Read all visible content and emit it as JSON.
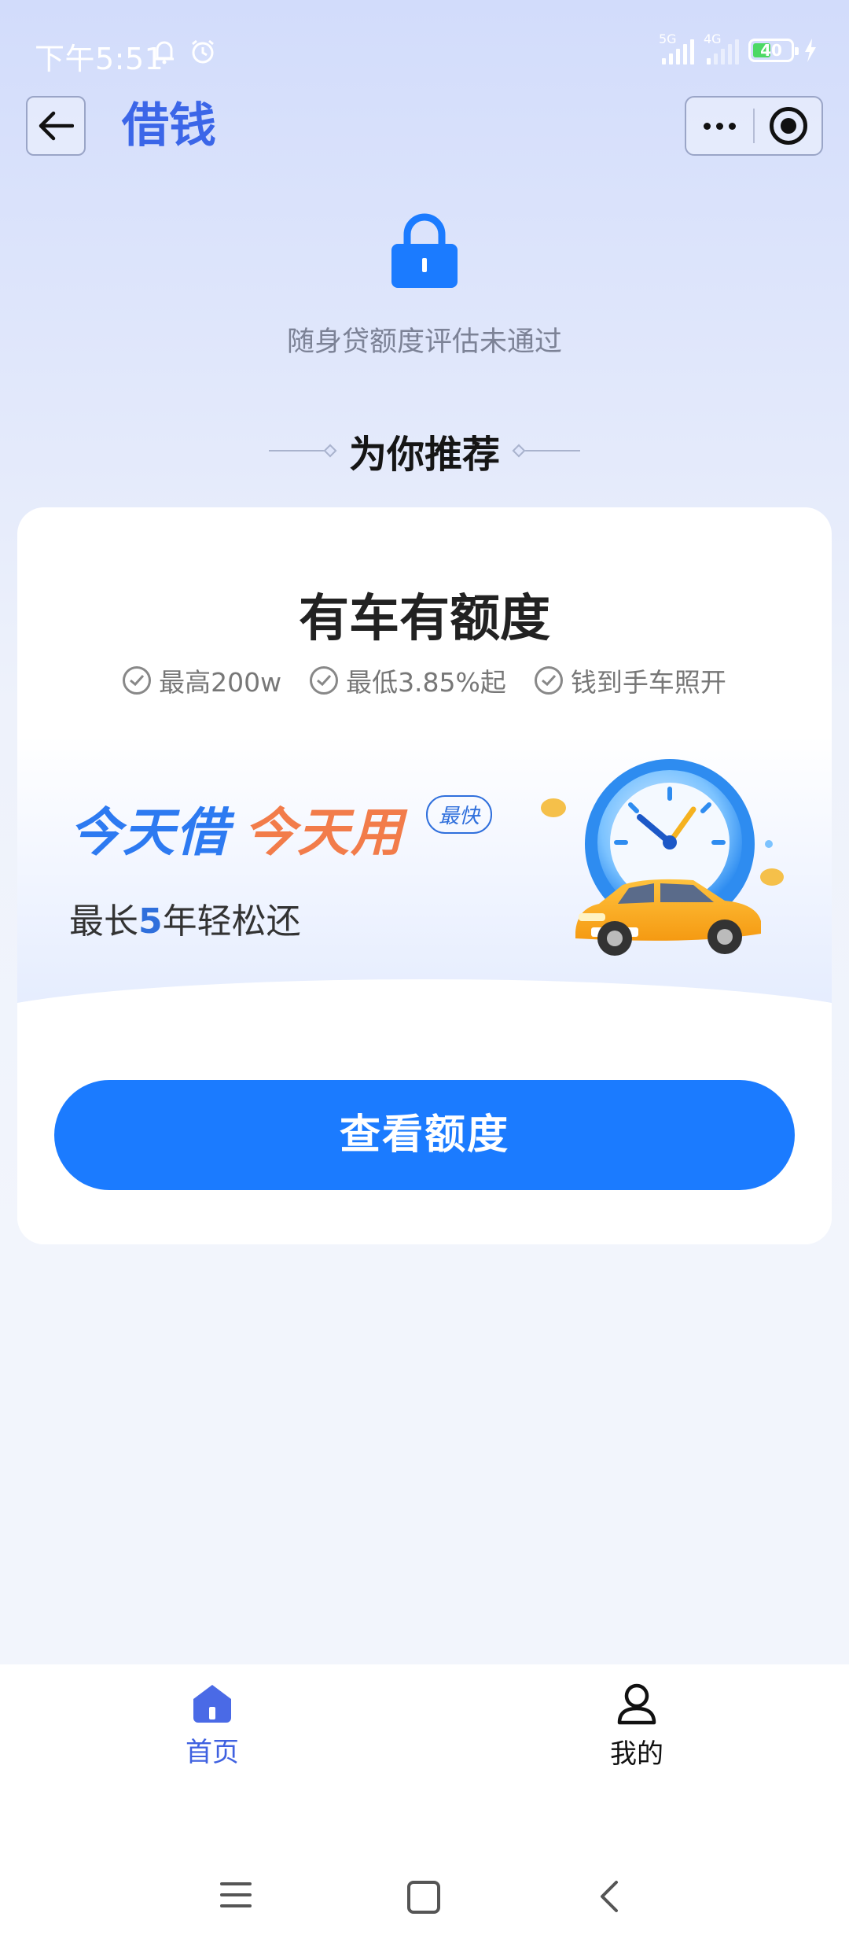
{
  "status_bar": {
    "time": "下午5:51",
    "signal1_tag": "5G",
    "signal2_tag": "4G",
    "battery": "40"
  },
  "header": {
    "title": "借钱"
  },
  "notice": {
    "message": "随身贷额度评估未通过"
  },
  "section": {
    "title": "为你推荐"
  },
  "card": {
    "title": "有车有额度",
    "features": [
      "最高200w",
      "最低3.85%起",
      "钱到手车照开"
    ],
    "slogan_part1": "今天借",
    "slogan_part2": "今天用",
    "badge": "最快",
    "subline_prefix": "最长",
    "subline_highlight": "5",
    "subline_suffix": "年轻松还",
    "cta_label": "查看额度"
  },
  "tabbar": {
    "items": [
      {
        "label": "首页",
        "icon": "home-icon",
        "active": true
      },
      {
        "label": "我的",
        "icon": "user-icon",
        "active": false
      }
    ]
  },
  "colors": {
    "brand_blue": "#1b7bff",
    "title_blue": "#3b66e8",
    "accent_orange": "#f27c4a"
  }
}
